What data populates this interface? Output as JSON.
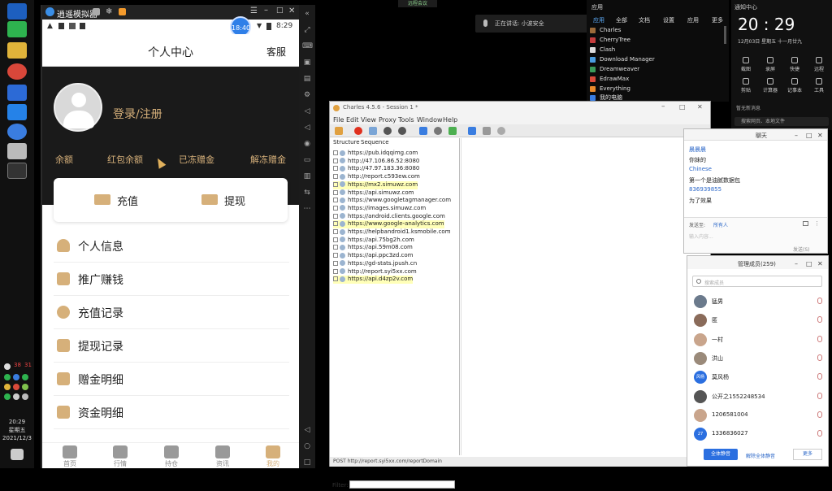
{
  "emulator": {
    "title": "逍遥模拟器",
    "time": "8:29",
    "badge_time": "18:40"
  },
  "phone": {
    "header_title": "个人中心",
    "service_label": "客服",
    "login_label": "登录/注册",
    "balances": [
      "余额",
      "红包余额",
      "已冻赠金",
      "解冻赠金"
    ],
    "recharge_label": "充值",
    "withdraw_label": "提现",
    "menu": [
      {
        "label": "个人信息",
        "icon": "user-icon"
      },
      {
        "label": "推广赚钱",
        "icon": "coins-icon"
      },
      {
        "label": "充值记录",
        "icon": "money-bag-icon"
      },
      {
        "label": "提现记录",
        "icon": "wallet-icon"
      },
      {
        "label": "赠金明细",
        "icon": "list-icon"
      },
      {
        "label": "资金明细",
        "icon": "ledger-icon"
      }
    ],
    "nav": [
      "首页",
      "行情",
      "持仓",
      "资讯",
      "我的"
    ]
  },
  "taskbar": {
    "clock_time": "20:29",
    "clock_day": "星期五",
    "clock_date": "2021/12/3",
    "tray_nums": [
      "38",
      "31"
    ]
  },
  "top_label": "正在讲话: 小波安全",
  "top_center": "远程会议",
  "apps_panel": {
    "tabs": [
      "应用",
      "全部",
      "文档",
      "设置",
      "应用",
      "更多"
    ],
    "title": "应用",
    "items": [
      "Charles",
      "CherryTree",
      "Clash",
      "Download Manager",
      "Dreamweaver",
      "EdrawMax",
      "Everything",
      "我的电脑"
    ]
  },
  "clock_panel": {
    "header": "通知中心",
    "time": "20 : 29",
    "date": "12月03日  星期五  十一月廿九",
    "actions": [
      "截图",
      "录屏",
      "快捷",
      "远程",
      "剪贴",
      "计算器",
      "记事本",
      "工具"
    ],
    "notice": "暂无新消息",
    "search_placeholder": "搜索网页、本地文件"
  },
  "charles": {
    "title": "Charles 4.5.6 - Session 1 *",
    "menu": [
      "File",
      "Edit",
      "View",
      "Proxy",
      "Tools",
      "Window",
      "Help"
    ],
    "tabs": [
      "Structure",
      "Sequence"
    ],
    "hosts": [
      "https://pub.idqqimg.com",
      "http://47.106.86.52:8080",
      "http://47.97.183.36:8080",
      "http://report.c593ew.com",
      "https://mx2.simuwz.com",
      "https://api.simuwz.com",
      "https://www.googletagmanager.com",
      "https://images.simuwz.com",
      "https://android.clients.google.com",
      "https://www.google-analytics.com",
      "https://helpbandroid1.ksmobile.com",
      "https://api.75bg2h.com",
      "https://api.59m08.com",
      "https://api.ppc3zd.com",
      "https://gd-stats.jpush.cn",
      "http://report.syi5xx.com",
      "https://api.d4zp2v.com"
    ],
    "highlighted": [
      4,
      9,
      16
    ],
    "filter_label": "Filter:",
    "status": "POST http://report.syi5xx.com/reportDomain"
  },
  "chat": {
    "title": "聊天",
    "lines": [
      {
        "text": "晨晨晨",
        "color": "#2b67c8"
      },
      {
        "text": "你妹的",
        "color": "#222"
      },
      {
        "text": "Chinese",
        "color": "#2b67c8"
      },
      {
        "text": "第一个是油腻数据包",
        "color": "#222"
      },
      {
        "text": "836939855",
        "color": "#2b67c8"
      },
      {
        "text": "为了效果",
        "color": "#222"
      }
    ],
    "send_to_label": "发送至:",
    "send_to_value": "所有人",
    "input_placeholder": "输入内容...",
    "send_label": "发送(S)"
  },
  "group": {
    "title": "管理成员(259)",
    "search_placeholder": "搜索成员",
    "members": [
      {
        "name": "猛男",
        "avatar": ""
      },
      {
        "name": "匿",
        "avatar": ""
      },
      {
        "name": "一村",
        "avatar": ""
      },
      {
        "name": "洪山",
        "avatar": ""
      },
      {
        "name": "莫风杨",
        "avatar": "风杨"
      },
      {
        "name": "公开之1552248534",
        "avatar": ""
      },
      {
        "name": "1206581004",
        "avatar": ""
      },
      {
        "name": "1336836027",
        "avatar": "27"
      }
    ],
    "mute_all": "全体静音",
    "unmute_all": "解除全体静音",
    "more": "更多"
  },
  "colors": {
    "gold": "#d6b07a",
    "banner": "#1a1a1a",
    "link_blue": "#2b67c8",
    "button_blue": "#2b6fe0"
  }
}
